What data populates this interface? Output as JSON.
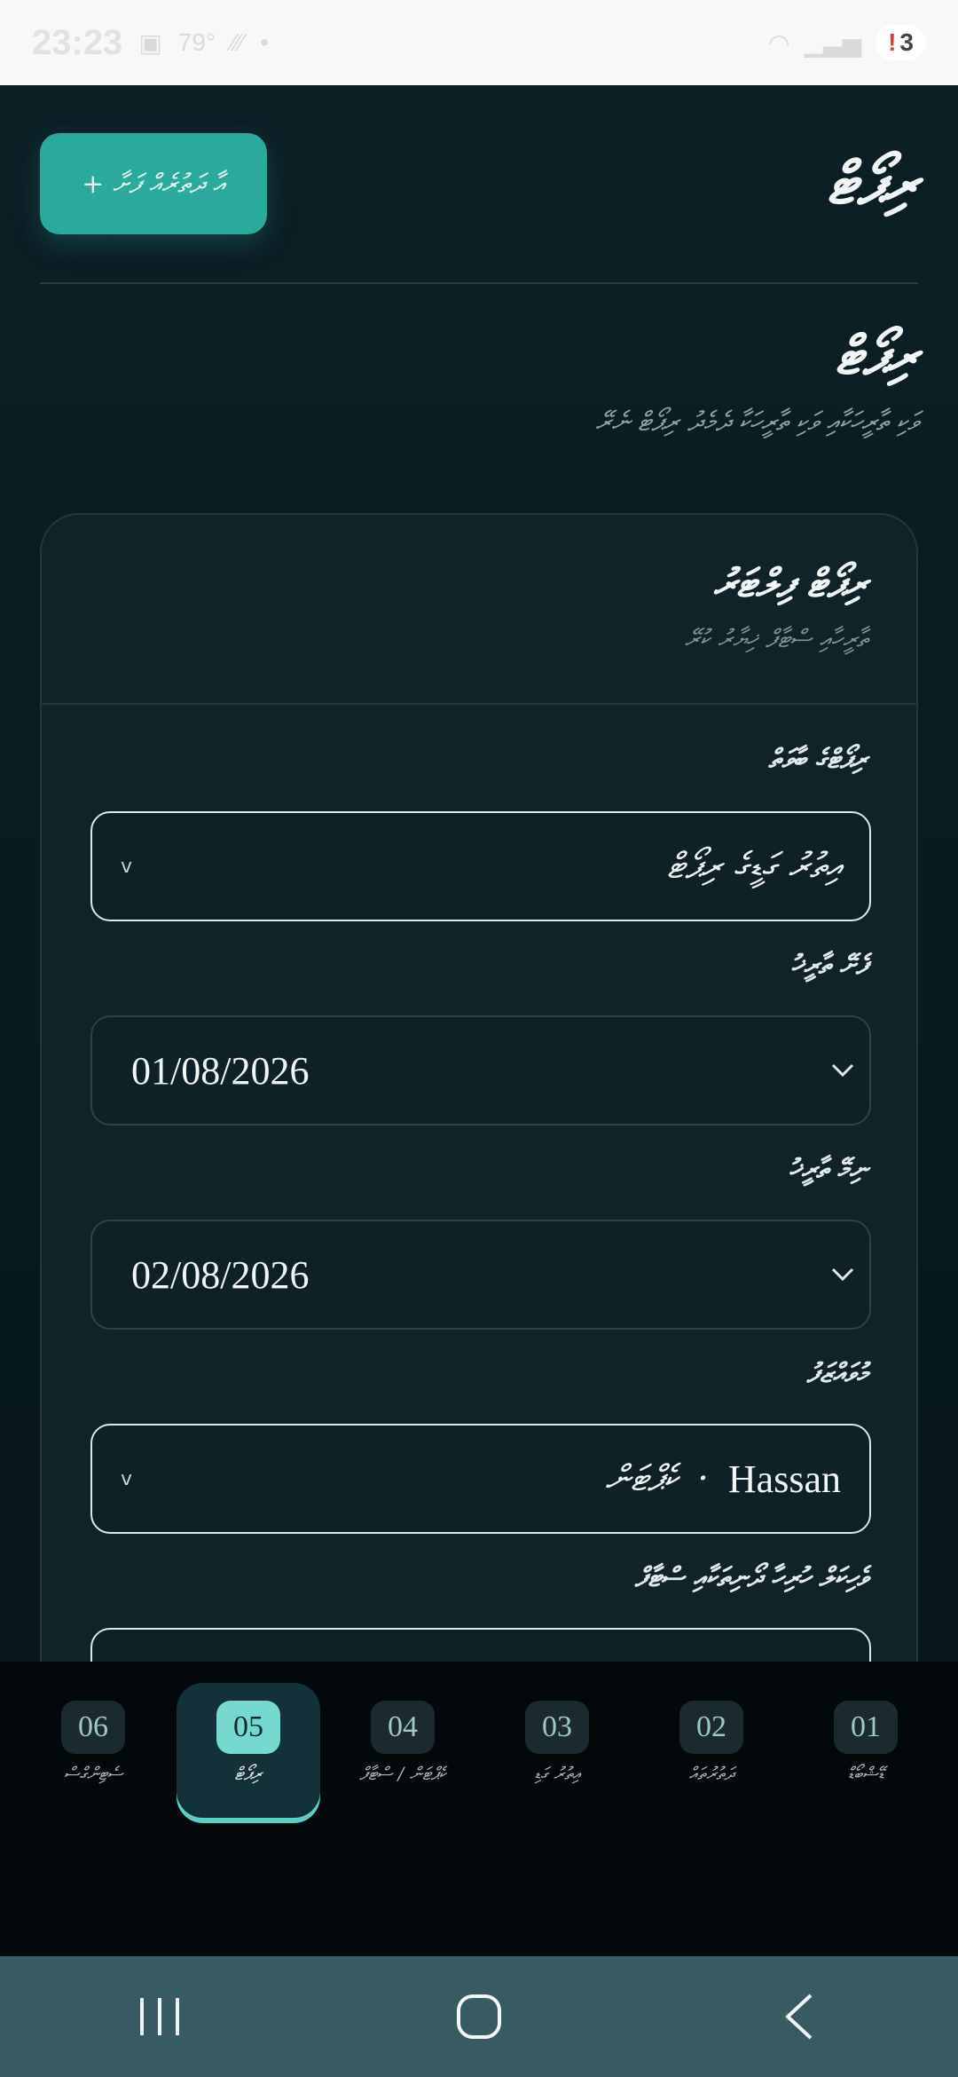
{
  "status_bar": {
    "time": "23:23",
    "temperature": "79°",
    "notification_count": "3",
    "alert_mark": "!"
  },
  "header": {
    "app_title": "ރިޕޯޓް",
    "add_button_label": "+ އާ ދަތުރެއް ފަށާ"
  },
  "page": {
    "title": "ރިޕޯޓް",
    "subtitle": "ވަކި ތާރީހަކާއި ވަކި ތާރީހަކާ ދެމެދު ރިޕޯޓް ނެރޭ"
  },
  "report_card": {
    "title": "ރިޕޯޓް ފިލްޓަރު",
    "subtitle": "ތާރީހާއި ސްޓާފް ޚިޔާރު ކުރޭ",
    "fields": {
      "report_type": {
        "label": "ރިޕޯޓްގެ ބާވަތް",
        "value": "އިތުރު ގަޑީގެ ރިޕޯޓް"
      },
      "from_date": {
        "label": "ފެށޭ ތާރީޚު",
        "value": "01/08/2026"
      },
      "to_date": {
        "label": "ނިމޭ ތާރީޚު",
        "value": "02/08/2026"
      },
      "employee": {
        "label": "މުވައްޒަފު",
        "value_name": "Hassan",
        "value_role": "ކެޕްޓަން",
        "separator": "·"
      },
      "vessel_label": "ވެހިކަލް ހުރިހާ ދޯނިތަކާއި ސްޓާފް"
    }
  },
  "bottom_tabs": [
    {
      "num": "01",
      "label": "ޑޭޝްބޯޑް"
    },
    {
      "num": "02",
      "label": "ދަތުރުތައް"
    },
    {
      "num": "03",
      "label": "އިތުރު ގަޑި"
    },
    {
      "num": "04",
      "label": "ކެޕްޓަން / ސްޓާފް"
    },
    {
      "num": "05",
      "label": "ރިޕޯޓް"
    },
    {
      "num": "06",
      "label": "ސެޓިންގްސް"
    }
  ],
  "active_tab": "05",
  "colors": {
    "accent": "#2aa99d",
    "accent_light": "#76d9cf",
    "background": "#0a1a1f",
    "nav_bar": "#375a63"
  }
}
